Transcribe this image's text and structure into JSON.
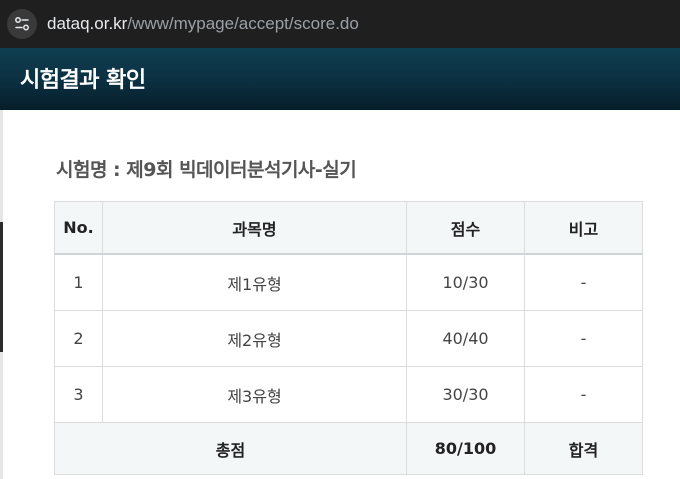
{
  "browser": {
    "url_host": "dataq.or.kr",
    "url_path": "/www/mypage/accept/score.do",
    "site_info_icon": "tune-icon"
  },
  "header": {
    "title": "시험결과 확인"
  },
  "exam": {
    "name": "시험명 : 제9회 빅데이터분석기사-실기"
  },
  "table": {
    "headers": [
      "No.",
      "과목명",
      "점수",
      "비고"
    ],
    "rows": [
      {
        "no": "1",
        "subject": "제1유형",
        "score": "10/30",
        "note": "-"
      },
      {
        "no": "2",
        "subject": "제2유형",
        "score": "40/40",
        "note": "-"
      },
      {
        "no": "3",
        "subject": "제3유형",
        "score": "30/30",
        "note": "-"
      }
    ],
    "total": {
      "label": "총점",
      "score": "80/100",
      "result": "합격"
    }
  },
  "colors": {
    "header_bg": "#0b2f40",
    "table_head_bg": "#f3f7f8",
    "addressbar_bg": "#1f1f1f"
  }
}
